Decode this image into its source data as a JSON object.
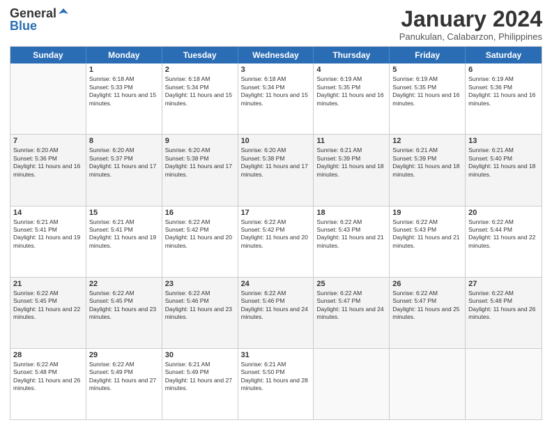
{
  "logo": {
    "general": "General",
    "blue": "Blue"
  },
  "title": "January 2024",
  "subtitle": "Panukulan, Calabarzon, Philippines",
  "days": [
    "Sunday",
    "Monday",
    "Tuesday",
    "Wednesday",
    "Thursday",
    "Friday",
    "Saturday"
  ],
  "rows": [
    [
      {
        "day": "",
        "sunrise": "",
        "sunset": "",
        "daylight": "",
        "empty": true
      },
      {
        "day": "1",
        "sunrise": "Sunrise: 6:18 AM",
        "sunset": "Sunset: 5:33 PM",
        "daylight": "Daylight: 11 hours and 15 minutes."
      },
      {
        "day": "2",
        "sunrise": "Sunrise: 6:18 AM",
        "sunset": "Sunset: 5:34 PM",
        "daylight": "Daylight: 11 hours and 15 minutes."
      },
      {
        "day": "3",
        "sunrise": "Sunrise: 6:18 AM",
        "sunset": "Sunset: 5:34 PM",
        "daylight": "Daylight: 11 hours and 15 minutes."
      },
      {
        "day": "4",
        "sunrise": "Sunrise: 6:19 AM",
        "sunset": "Sunset: 5:35 PM",
        "daylight": "Daylight: 11 hours and 16 minutes."
      },
      {
        "day": "5",
        "sunrise": "Sunrise: 6:19 AM",
        "sunset": "Sunset: 5:35 PM",
        "daylight": "Daylight: 11 hours and 16 minutes."
      },
      {
        "day": "6",
        "sunrise": "Sunrise: 6:19 AM",
        "sunset": "Sunset: 5:36 PM",
        "daylight": "Daylight: 11 hours and 16 minutes."
      }
    ],
    [
      {
        "day": "7",
        "sunrise": "Sunrise: 6:20 AM",
        "sunset": "Sunset: 5:36 PM",
        "daylight": "Daylight: 11 hours and 16 minutes."
      },
      {
        "day": "8",
        "sunrise": "Sunrise: 6:20 AM",
        "sunset": "Sunset: 5:37 PM",
        "daylight": "Daylight: 11 hours and 17 minutes."
      },
      {
        "day": "9",
        "sunrise": "Sunrise: 6:20 AM",
        "sunset": "Sunset: 5:38 PM",
        "daylight": "Daylight: 11 hours and 17 minutes."
      },
      {
        "day": "10",
        "sunrise": "Sunrise: 6:20 AM",
        "sunset": "Sunset: 5:38 PM",
        "daylight": "Daylight: 11 hours and 17 minutes."
      },
      {
        "day": "11",
        "sunrise": "Sunrise: 6:21 AM",
        "sunset": "Sunset: 5:39 PM",
        "daylight": "Daylight: 11 hours and 18 minutes."
      },
      {
        "day": "12",
        "sunrise": "Sunrise: 6:21 AM",
        "sunset": "Sunset: 5:39 PM",
        "daylight": "Daylight: 11 hours and 18 minutes."
      },
      {
        "day": "13",
        "sunrise": "Sunrise: 6:21 AM",
        "sunset": "Sunset: 5:40 PM",
        "daylight": "Daylight: 11 hours and 18 minutes."
      }
    ],
    [
      {
        "day": "14",
        "sunrise": "Sunrise: 6:21 AM",
        "sunset": "Sunset: 5:41 PM",
        "daylight": "Daylight: 11 hours and 19 minutes."
      },
      {
        "day": "15",
        "sunrise": "Sunrise: 6:21 AM",
        "sunset": "Sunset: 5:41 PM",
        "daylight": "Daylight: 11 hours and 19 minutes."
      },
      {
        "day": "16",
        "sunrise": "Sunrise: 6:22 AM",
        "sunset": "Sunset: 5:42 PM",
        "daylight": "Daylight: 11 hours and 20 minutes."
      },
      {
        "day": "17",
        "sunrise": "Sunrise: 6:22 AM",
        "sunset": "Sunset: 5:42 PM",
        "daylight": "Daylight: 11 hours and 20 minutes."
      },
      {
        "day": "18",
        "sunrise": "Sunrise: 6:22 AM",
        "sunset": "Sunset: 5:43 PM",
        "daylight": "Daylight: 11 hours and 21 minutes."
      },
      {
        "day": "19",
        "sunrise": "Sunrise: 6:22 AM",
        "sunset": "Sunset: 5:43 PM",
        "daylight": "Daylight: 11 hours and 21 minutes."
      },
      {
        "day": "20",
        "sunrise": "Sunrise: 6:22 AM",
        "sunset": "Sunset: 5:44 PM",
        "daylight": "Daylight: 11 hours and 22 minutes."
      }
    ],
    [
      {
        "day": "21",
        "sunrise": "Sunrise: 6:22 AM",
        "sunset": "Sunset: 5:45 PM",
        "daylight": "Daylight: 11 hours and 22 minutes."
      },
      {
        "day": "22",
        "sunrise": "Sunrise: 6:22 AM",
        "sunset": "Sunset: 5:45 PM",
        "daylight": "Daylight: 11 hours and 23 minutes."
      },
      {
        "day": "23",
        "sunrise": "Sunrise: 6:22 AM",
        "sunset": "Sunset: 5:46 PM",
        "daylight": "Daylight: 11 hours and 23 minutes."
      },
      {
        "day": "24",
        "sunrise": "Sunrise: 6:22 AM",
        "sunset": "Sunset: 5:46 PM",
        "daylight": "Daylight: 11 hours and 24 minutes."
      },
      {
        "day": "25",
        "sunrise": "Sunrise: 6:22 AM",
        "sunset": "Sunset: 5:47 PM",
        "daylight": "Daylight: 11 hours and 24 minutes."
      },
      {
        "day": "26",
        "sunrise": "Sunrise: 6:22 AM",
        "sunset": "Sunset: 5:47 PM",
        "daylight": "Daylight: 11 hours and 25 minutes."
      },
      {
        "day": "27",
        "sunrise": "Sunrise: 6:22 AM",
        "sunset": "Sunset: 5:48 PM",
        "daylight": "Daylight: 11 hours and 26 minutes."
      }
    ],
    [
      {
        "day": "28",
        "sunrise": "Sunrise: 6:22 AM",
        "sunset": "Sunset: 5:48 PM",
        "daylight": "Daylight: 11 hours and 26 minutes."
      },
      {
        "day": "29",
        "sunrise": "Sunrise: 6:22 AM",
        "sunset": "Sunset: 5:49 PM",
        "daylight": "Daylight: 11 hours and 27 minutes."
      },
      {
        "day": "30",
        "sunrise": "Sunrise: 6:21 AM",
        "sunset": "Sunset: 5:49 PM",
        "daylight": "Daylight: 11 hours and 27 minutes."
      },
      {
        "day": "31",
        "sunrise": "Sunrise: 6:21 AM",
        "sunset": "Sunset: 5:50 PM",
        "daylight": "Daylight: 11 hours and 28 minutes."
      },
      {
        "day": "",
        "sunrise": "",
        "sunset": "",
        "daylight": "",
        "empty": true
      },
      {
        "day": "",
        "sunrise": "",
        "sunset": "",
        "daylight": "",
        "empty": true
      },
      {
        "day": "",
        "sunrise": "",
        "sunset": "",
        "daylight": "",
        "empty": true
      }
    ]
  ],
  "row_shades": [
    false,
    true,
    false,
    true,
    false
  ]
}
